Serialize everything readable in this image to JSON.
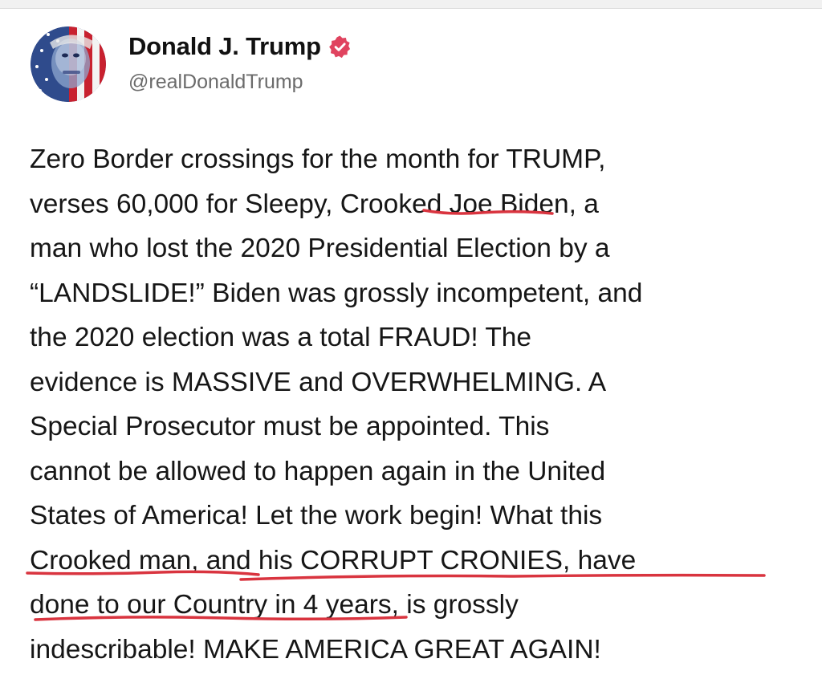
{
  "author": {
    "display_name": "Donald J. Trump",
    "handle": "@realDonaldTrump",
    "avatar_icon": "flag-portrait-avatar",
    "verified_icon": "verified-badge-icon",
    "verified_color": "#e0435f"
  },
  "post": {
    "lines": [
      "Zero Border crossings for the month for TRUMP,",
      "verses 60,000 for Sleepy, Crooked Joe Biden, a",
      "man who lost the 2020 Presidential Election by a",
      "“LANDSLIDE!” Biden was grossly incompetent, and",
      "the 2020 election was a total FRAUD! The",
      "evidence is MASSIVE and OVERWHELMING. A",
      "Special Prosecutor must be appointed. This",
      "cannot be allowed to happen again in the United",
      "States of America! Let the work begin! What this",
      "Crooked man, and his CORRUPT CRONIES, have",
      "done to our Country in 4 years, is grossly",
      "indescribable! MAKE AMERICA GREAT AGAIN!"
    ]
  },
  "annotation_color": "#d9343f"
}
